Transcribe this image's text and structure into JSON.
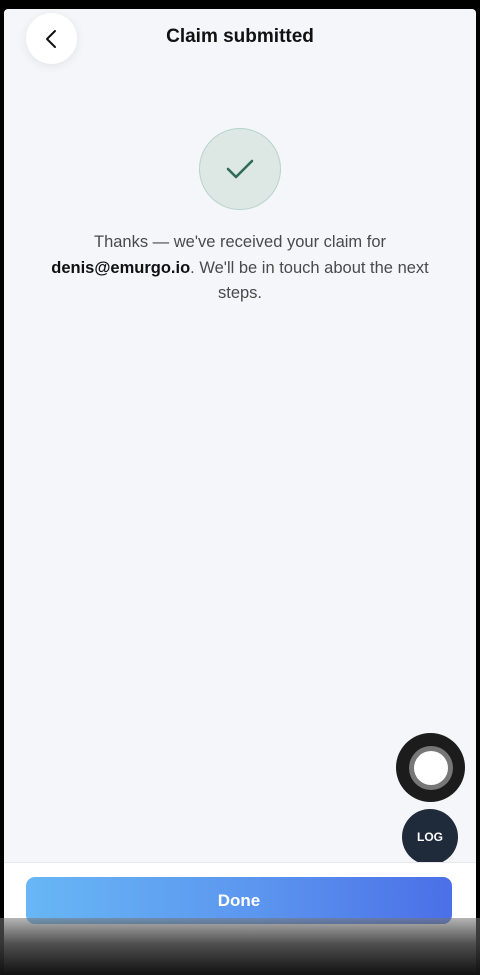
{
  "header": {
    "title": "Claim submitted",
    "back_icon": "chevron-left-icon"
  },
  "confirmation": {
    "icon": "checkmark-icon",
    "message_before": "Thanks — we've received your claim for ",
    "email": "denis@emurgo.io",
    "message_after": ". We'll be in touch about the next steps."
  },
  "floating": {
    "record_icon": "record-icon",
    "log_label": "LOG"
  },
  "footer": {
    "done_label": "Done"
  },
  "colors": {
    "background": "#f5f6fa",
    "check_bg": "#dde8e5",
    "check_stroke": "#2f6b55",
    "button_gradient_start": "#68b7f5",
    "button_gradient_end": "#4b6fe7",
    "log_bg": "#1f2a3a"
  }
}
